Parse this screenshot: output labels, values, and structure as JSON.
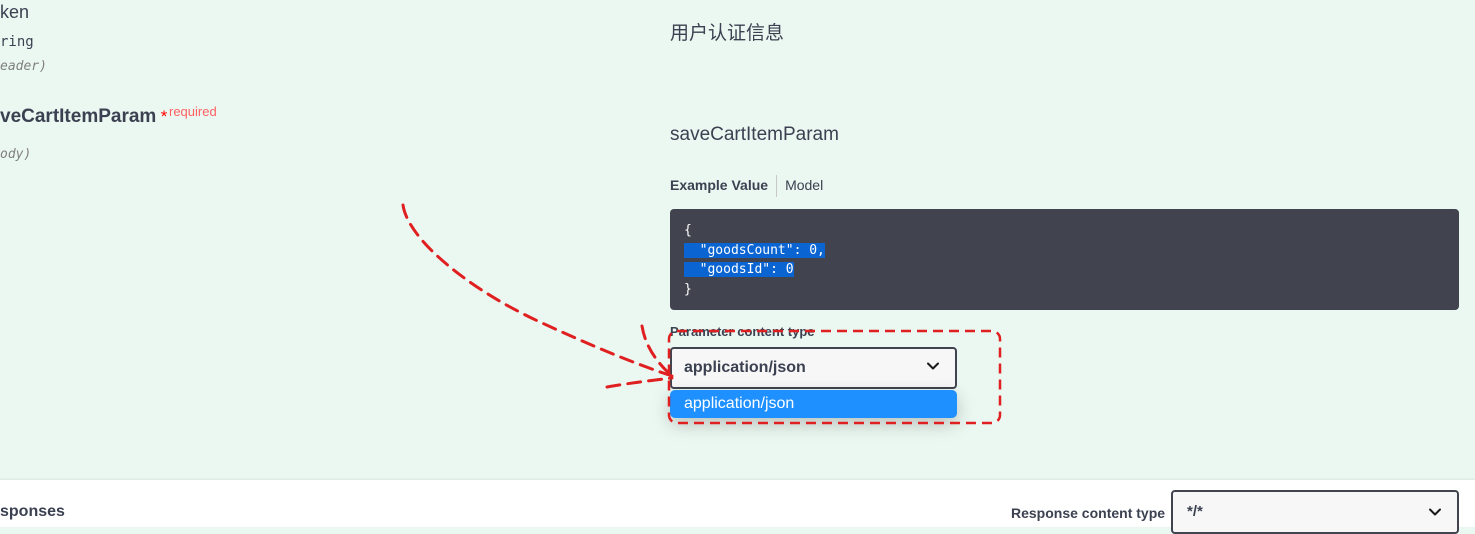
{
  "params": {
    "first": {
      "name_fragment": "ken",
      "type_fragment": "ring",
      "in_fragment": "eader)"
    },
    "second": {
      "name_fragment": "veCartItemParam",
      "required_star": "*",
      "required_label": "required",
      "in_fragment": "ody)"
    }
  },
  "right": {
    "first_description": "用户认证信息",
    "second_description": "saveCartItemParam",
    "tabs": [
      "Example Value",
      "Model"
    ],
    "code_lines": [
      "{",
      "  \"goodsCount\": 0,",
      "  \"goodsId\": 0",
      "}"
    ],
    "param_content_type_label": "Parameter content type",
    "param_content_type_value": "application/json",
    "dropdown_option": "application/json"
  },
  "responses": {
    "title_fragment": "sponses",
    "content_type_label": "Response content type",
    "content_type_value": "*/*"
  },
  "colors": {
    "background": "#ebf7f1",
    "code_background": "#41444e",
    "highlight": "#0a64d2",
    "dropdown_selected": "#1e90ff",
    "annotation_red": "#e02020",
    "required": "#ff0000"
  },
  "icons": [
    "chevron-down-icon"
  ]
}
